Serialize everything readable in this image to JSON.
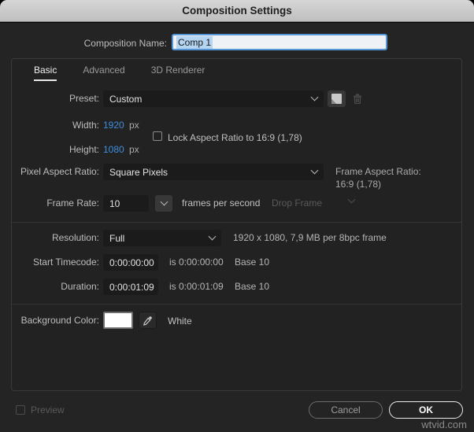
{
  "title": "Composition Settings",
  "composition_name": {
    "label": "Composition Name:",
    "value": "Comp 1"
  },
  "tabs": {
    "basic": "Basic",
    "advanced": "Advanced",
    "renderer": "3D Renderer"
  },
  "preset": {
    "label": "Preset:",
    "value": "Custom"
  },
  "width": {
    "label": "Width:",
    "value": "1920",
    "unit": "px"
  },
  "height": {
    "label": "Height:",
    "value": "1080",
    "unit": "px"
  },
  "lock_aspect": {
    "label": "Lock Aspect Ratio to 16:9 (1,78)",
    "checked": false
  },
  "pixel_aspect_ratio": {
    "label": "Pixel Aspect Ratio:",
    "value": "Square Pixels"
  },
  "frame_aspect_ratio": {
    "label": "Frame Aspect Ratio:",
    "value": "16:9 (1,78)"
  },
  "frame_rate": {
    "label": "Frame Rate:",
    "value": "10",
    "unit": "frames per second",
    "drop_frame": "Drop Frame"
  },
  "resolution": {
    "label": "Resolution:",
    "value": "Full",
    "info": "1920 x 1080, 7,9 MB per 8bpc frame"
  },
  "start_timecode": {
    "label": "Start Timecode:",
    "value": "0:00:00:00",
    "is_text": "is 0:00:00:00",
    "base_text": "Base 10"
  },
  "duration": {
    "label": "Duration:",
    "value": "0:00:01:09",
    "is_text": "is 0:00:01:09",
    "base_text": "Base 10"
  },
  "background_color": {
    "label": "Background Color:",
    "swatch_color": "#ffffff",
    "color_name": "White"
  },
  "footer": {
    "preview_label": "Preview",
    "cancel_label": "Cancel",
    "ok_label": "OK"
  },
  "watermark": "wtvid.com",
  "colors": {
    "value_blue": "#3e8edd",
    "focus_border": "#5596d8",
    "panel_bg": "#222222",
    "dialog_bg": "#242424",
    "titlebar_bg": "#c9c9c9"
  }
}
